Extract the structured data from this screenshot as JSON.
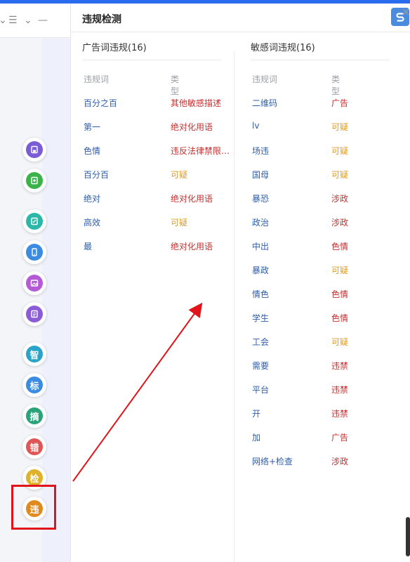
{
  "panel": {
    "title": "违规检测",
    "left": {
      "title": "广告词违规(16)",
      "col_word": "违规词",
      "col_type": "类型",
      "rows": [
        {
          "word": "百分之百",
          "type": "其他敏感描述",
          "color": "#c53030"
        },
        {
          "word": "第一",
          "type": "绝对化用语",
          "color": "#c53030"
        },
        {
          "word": "色情",
          "type": "违反法律禁限…",
          "color": "#c53030"
        },
        {
          "word": "百分百",
          "type": "可疑",
          "color": "#e09b2a"
        },
        {
          "word": "绝对",
          "type": "绝对化用语",
          "color": "#c53030"
        },
        {
          "word": "高效",
          "type": "可疑",
          "color": "#e09b2a"
        },
        {
          "word": "最",
          "type": "绝对化用语",
          "color": "#c53030"
        }
      ]
    },
    "right": {
      "title": "敏感词违规(16)",
      "col_word": "违规词",
      "col_type": "类型",
      "rows": [
        {
          "word": "二维码",
          "type": "广告",
          "color": "#c53030"
        },
        {
          "word": "lv",
          "type": "可疑",
          "color": "#e09b2a"
        },
        {
          "word": "场违",
          "type": "可疑",
          "color": "#e09b2a"
        },
        {
          "word": "国母",
          "type": "可疑",
          "color": "#e09b2a"
        },
        {
          "word": "暴恐",
          "type": "涉政",
          "color": "#c53030"
        },
        {
          "word": "政治",
          "type": "涉政",
          "color": "#c53030"
        },
        {
          "word": "中出",
          "type": "色情",
          "color": "#c53030"
        },
        {
          "word": "暴政",
          "type": "可疑",
          "color": "#e09b2a"
        },
        {
          "word": "情色",
          "type": "色情",
          "color": "#c53030"
        },
        {
          "word": "学生",
          "type": "色情",
          "color": "#c53030"
        },
        {
          "word": "工会",
          "type": "可疑",
          "color": "#e09b2a"
        },
        {
          "word": "需要",
          "type": "违禁",
          "color": "#c53030"
        },
        {
          "word": "平台",
          "type": "违禁",
          "color": "#c53030"
        },
        {
          "word": "开",
          "type": "违禁",
          "color": "#c53030"
        },
        {
          "word": "加",
          "type": "广告",
          "color": "#c53030"
        },
        {
          "word": "网络+检查",
          "type": "涉政",
          "color": "#c53030"
        }
      ]
    }
  },
  "tools": [
    {
      "name": "save-icon",
      "label": "",
      "color": "#7a5cd6"
    },
    {
      "name": "doc-add-icon",
      "label": "",
      "color": "#3bb34a"
    },
    {
      "name": "note-icon",
      "label": "",
      "color": "#2bb8a8"
    },
    {
      "name": "phone-icon",
      "label": "",
      "color": "#3b8be0"
    },
    {
      "name": "image-icon",
      "label": "",
      "color": "#b45ad6"
    },
    {
      "name": "list-doc-icon",
      "label": "",
      "color": "#8c5bd6"
    },
    {
      "name": "smart-icon",
      "label": "智",
      "color": "#2aa3c9"
    },
    {
      "name": "title-icon",
      "label": "标",
      "color": "#3b8be0"
    },
    {
      "name": "summary-icon",
      "label": "摘",
      "color": "#2aa37a"
    },
    {
      "name": "error-icon",
      "label": "错",
      "color": "#e05555"
    },
    {
      "name": "check-icon",
      "label": "检",
      "color": "#e0b22a"
    },
    {
      "name": "violation-icon",
      "label": "违",
      "color": "#e08a1e"
    }
  ],
  "colors": {
    "accent": "#2a6bf0",
    "highlight": "#e0141a"
  }
}
